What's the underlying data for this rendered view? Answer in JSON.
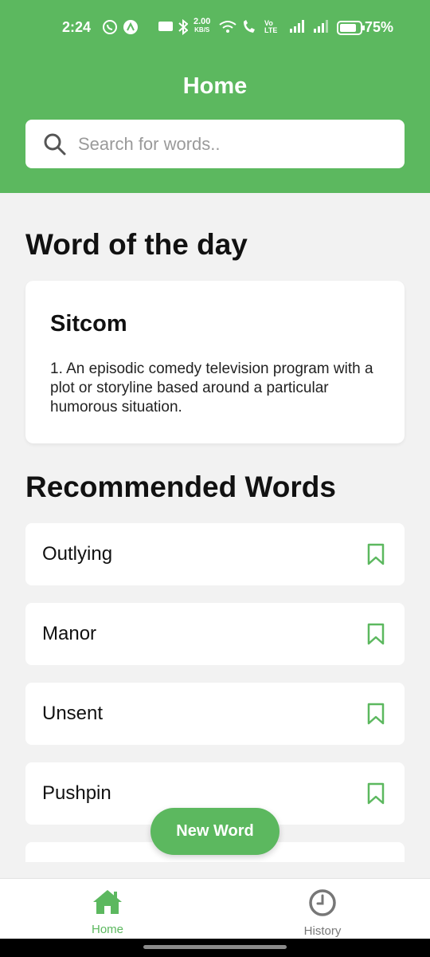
{
  "status_bar": {
    "time": "2:24",
    "speed_value": "2.00",
    "speed_unit": "KB/S",
    "battery": "75%"
  },
  "header": {
    "title": "Home",
    "search_placeholder": "Search for words.."
  },
  "word_of_day": {
    "heading": "Word of the day",
    "word": "Sitcom",
    "definition": "1. An episodic comedy television program with a plot or storyline based around a particular humorous situation."
  },
  "recommended": {
    "heading": "Recommended Words",
    "items": [
      {
        "label": "Outlying",
        "icon": "bookmark-icon"
      },
      {
        "label": "Manor",
        "icon": "bookmark-icon"
      },
      {
        "label": "Unsent",
        "icon": "bookmark-icon"
      },
      {
        "label": "Pushpin",
        "icon": "bookmark-icon"
      }
    ]
  },
  "fab": {
    "label": "New Word"
  },
  "bottom_nav": {
    "items": [
      {
        "label": "Home",
        "icon": "home-icon",
        "active": true
      },
      {
        "label": "History",
        "icon": "clock-icon",
        "active": false
      }
    ]
  },
  "colors": {
    "accent": "#5cb85f",
    "background": "#f2f2f2",
    "card": "#ffffff"
  }
}
